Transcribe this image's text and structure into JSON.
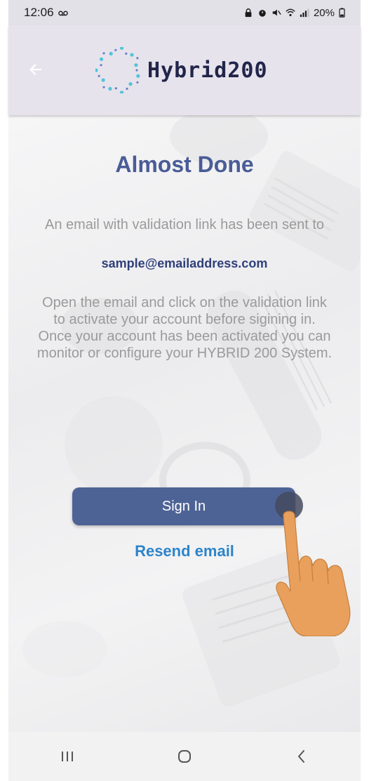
{
  "status_bar": {
    "time": "12:06",
    "battery": "20%",
    "icons": [
      "voicemail-icon",
      "lock-icon",
      "alarm-icon",
      "mute-icon",
      "wifi-icon",
      "signal-icon",
      "battery-icon"
    ]
  },
  "header": {
    "logo_text": "Hybrid200",
    "back_icon": "arrow-left-icon"
  },
  "main": {
    "title": "Almost Done",
    "email_sent_text": "An email with validation link has been sent to",
    "email_address": "sample@emailaddress.com",
    "instructions": "Open the email and click on the validation link to activate your account before sigining in.\nOnce your account has been activated you can monitor or configure your HYBRID 200 System.",
    "signin_label": "Sign In",
    "resend_label": "Resend email"
  },
  "nav": {
    "icons": [
      "recent-apps-icon",
      "home-icon",
      "back-icon"
    ]
  },
  "colors": {
    "title": "#4a5c96",
    "button": "#4e6395",
    "link": "#2d84c9",
    "header_bg": "#e6e3ec",
    "hand": "#e8a05c"
  }
}
